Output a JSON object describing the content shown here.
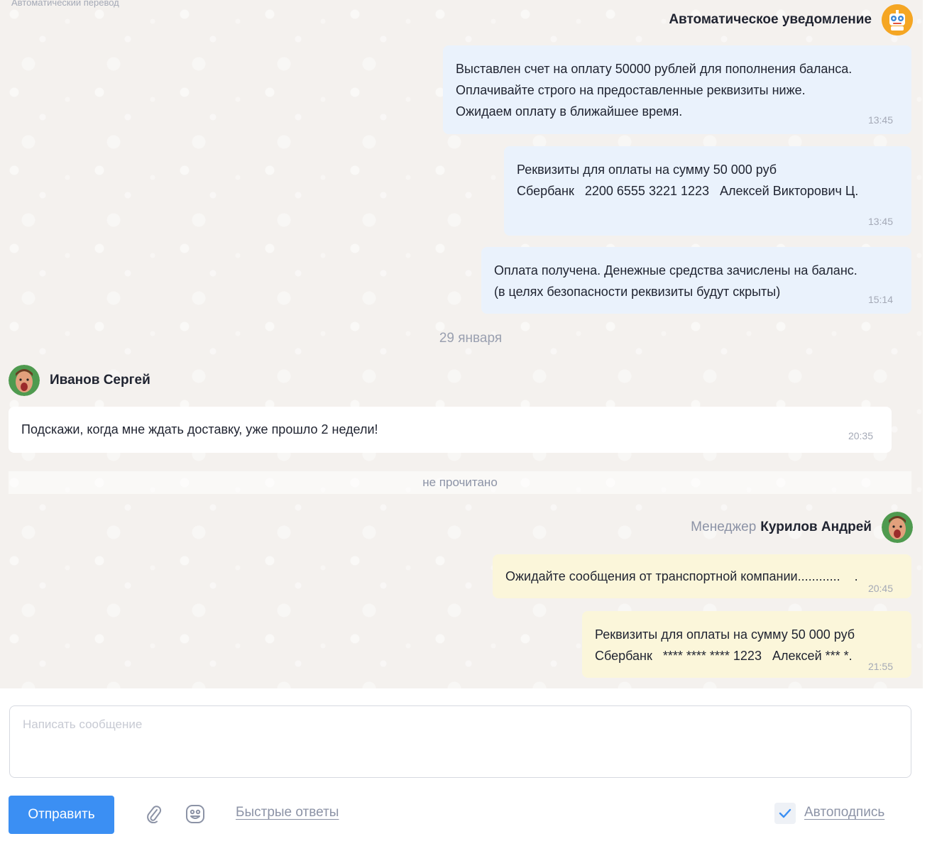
{
  "chat": {
    "top_label": "Автоматический перевод",
    "auto_sender": "Автоматическое уведомление",
    "messages_auto": [
      {
        "lines": [
          "Выставлен счет на оплату 50000 рублей для пополнения баланса.",
          "Оплачивайте строго на предоставленные реквизиты ниже.",
          "Ожидаем оплату в ближайшее время."
        ],
        "time": "13:45"
      },
      {
        "lines": [
          "Реквизиты для оплаты на сумму 50 000 руб",
          "Сбербанк   2200 6555 3221 1223   Алексей Викторович Ц."
        ],
        "time": "13:45"
      },
      {
        "lines": [
          "Оплата получена. Денежные средства зачислены на баланс.",
          "(в целях безопасности реквизиты будут скрыты)"
        ],
        "time": "15:14"
      }
    ],
    "date_separator": "29 января",
    "client_name": "Иванов Сергей",
    "client_message": {
      "text": "Подскажи, когда мне ждать доставку, уже прошло 2 недели!",
      "time": "20:35"
    },
    "unread_label": "не прочитано",
    "manager_role": "Менеджер",
    "manager_name": "Курилов Андрей",
    "manager_messages": [
      {
        "lines": [
          "Ожидайте сообщения от транспортной компании............    ."
        ],
        "time": "20:45"
      },
      {
        "lines": [
          "Реквизиты для оплаты на сумму 50 000 руб",
          "Сбербанк   **** **** **** 1223   Алексей *** *."
        ],
        "time": "21:55"
      }
    ]
  },
  "composer": {
    "placeholder": "Написать сообщение",
    "send_label": "Отправить",
    "quick_replies_label": "Быстрые ответы",
    "autosign_label": "Автоподпись",
    "autosign_checked": true
  },
  "colors": {
    "accent": "#3b8ff3",
    "bubble_auto": "#eaf2fc",
    "bubble_manager": "#fbf6da",
    "bubble_client": "#ffffff"
  },
  "icons": [
    "robot-avatar-icon",
    "attach-icon",
    "emoji-icon",
    "check-icon"
  ]
}
